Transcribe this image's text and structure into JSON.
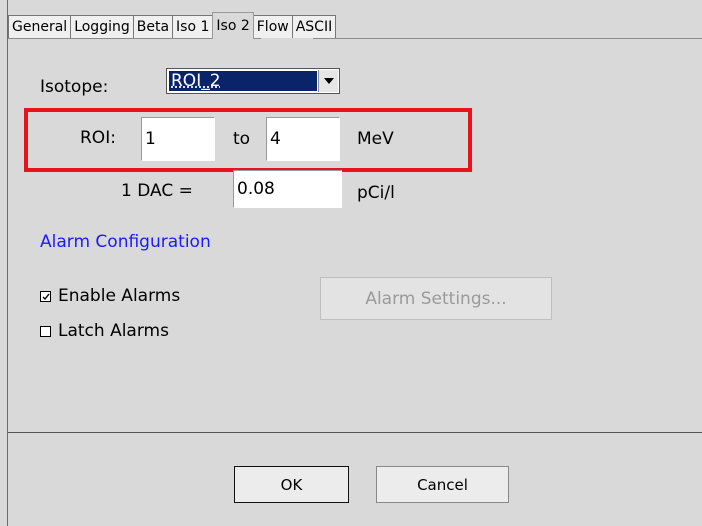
{
  "tabs": [
    {
      "label": "General"
    },
    {
      "label": "Logging"
    },
    {
      "label": "Beta"
    },
    {
      "label": "Iso 1"
    },
    {
      "label": "Iso 2"
    },
    {
      "label": "Flow"
    },
    {
      "label": "ASCII"
    }
  ],
  "active_tab": "Iso 2",
  "isotope": {
    "label": "Isotope:",
    "selected": "ROI_2"
  },
  "roi": {
    "label": "ROI:",
    "from": "1",
    "to_label": "to",
    "to": "4",
    "unit": "MeV"
  },
  "dac": {
    "label": "1 DAC =",
    "value": "0.08",
    "unit": "pCi/l"
  },
  "alarm": {
    "section_title": "Alarm Configuration",
    "enable_label": "Enable Alarms",
    "enable_checked": true,
    "latch_label": "Latch Alarms",
    "latch_checked": false,
    "settings_button": "Alarm Settings..."
  },
  "footer": {
    "ok_label": "OK",
    "cancel_label": "Cancel"
  },
  "colors": {
    "highlight": "#e8141b",
    "section_title": "#1a1aff",
    "selection": "#0a246a"
  }
}
